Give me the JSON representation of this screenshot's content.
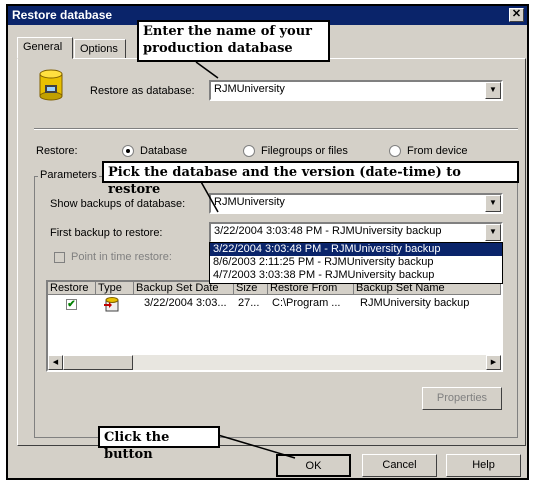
{
  "window": {
    "title": "Restore database",
    "close_glyph": "✕"
  },
  "tabs": {
    "general": "General",
    "options": "Options"
  },
  "restore_as": {
    "label": "Restore as database:",
    "value": "RJMUniversity"
  },
  "restore": {
    "label": "Restore:",
    "options": {
      "database": "Database",
      "filegroups": "Filegroups or files",
      "device": "From device"
    },
    "selected": "database"
  },
  "parameters": {
    "legend": "Parameters",
    "show_backups_label": "Show backups of database:",
    "show_backups_value": "RJMUniversity",
    "first_backup_label": "First backup to restore:",
    "first_backup_value": "3/22/2004 3:03:48 PM - RJMUniversity backup",
    "dropdown_options": [
      "3/22/2004 3:03:48 PM - RJMUniversity backup",
      "8/6/2003 2:11:25 PM - RJMUniversity backup",
      "4/7/2003 3:03:38 PM - RJMUniversity backup"
    ],
    "point_in_time_label": "Point in time restore:"
  },
  "backup_table": {
    "columns": [
      "Restore",
      "Type",
      "Backup Set Date",
      "Size",
      "Restore From",
      "Backup Set Name"
    ],
    "rows": [
      {
        "restore": "✔",
        "date": "3/22/2004 3:03...",
        "size": "27...",
        "from": "C:\\Program ...",
        "name": "RJMUniversity backup"
      }
    ]
  },
  "buttons": {
    "properties": "Properties",
    "ok": "OK",
    "cancel": "Cancel",
    "help": "Help"
  },
  "annotations": {
    "name_db": "Enter the name of your production database",
    "pick_db": "Pick the database and the version (date-time) to restore",
    "click_button": "Click the button"
  },
  "colors": {
    "titlebar": "#0a246a",
    "dialog_bg": "#d4d0c8",
    "selection": "#0a246a",
    "check": "#008000"
  },
  "icons": {
    "database": "database-icon",
    "backup_type": "backup-type-icon",
    "checkbox": "checkmark-icon"
  }
}
